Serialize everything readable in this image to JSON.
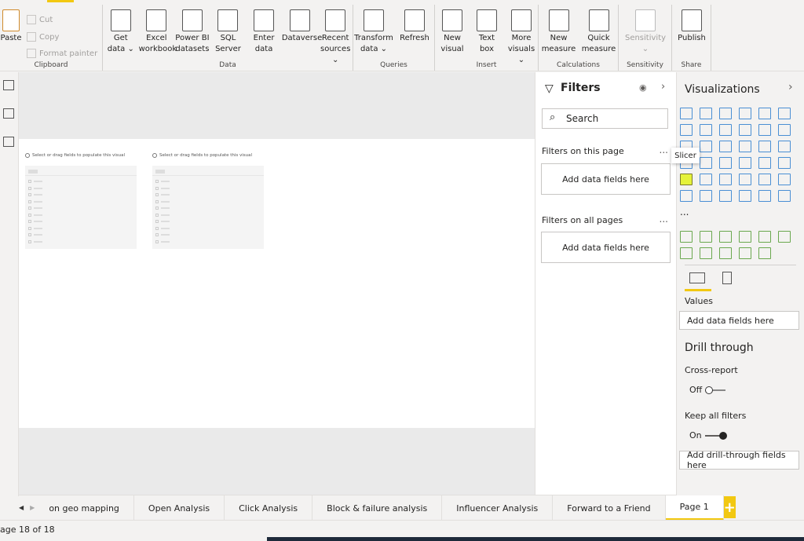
{
  "ribbon": {
    "clipboard": {
      "label": "Clipboard",
      "paste": "Paste",
      "cut": "Cut",
      "copy": "Copy",
      "format_painter": "Format painter"
    },
    "data": {
      "label": "Data",
      "buttons": [
        [
          "Get",
          "data ⌄"
        ],
        [
          "Excel",
          "workbook"
        ],
        [
          "Power BI",
          "datasets"
        ],
        [
          "SQL",
          "Server"
        ],
        [
          "Enter",
          "data"
        ],
        [
          "Dataverse",
          ""
        ],
        [
          "Recent",
          "sources ⌄"
        ]
      ]
    },
    "queries": {
      "label": "Queries",
      "buttons": [
        [
          "Transform",
          "data ⌄"
        ],
        [
          "Refresh",
          ""
        ]
      ]
    },
    "insert": {
      "label": "Insert",
      "buttons": [
        [
          "New",
          "visual"
        ],
        [
          "Text",
          "box"
        ],
        [
          "More",
          "visuals ⌄"
        ]
      ]
    },
    "calculations": {
      "label": "Calculations",
      "buttons": [
        [
          "New",
          "measure"
        ],
        [
          "Quick",
          "measure"
        ]
      ]
    },
    "sensitivity": {
      "label": "Sensitivity",
      "buttons": [
        [
          "Sensitivity",
          "⌄"
        ]
      ]
    },
    "share": {
      "label": "Share",
      "buttons": [
        [
          "Publish",
          ""
        ]
      ]
    }
  },
  "canvas": {
    "visuals": [
      {
        "message": "Select or drag fields to populate this visual"
      },
      {
        "message": "Select or drag fields to populate this visual"
      }
    ]
  },
  "filters": {
    "title": "Filters",
    "search_placeholder": "Search",
    "on_this_page": "Filters on this page",
    "on_all_pages": "Filters on all pages",
    "add_fields": "Add data fields here",
    "more": "..."
  },
  "visualizations": {
    "title": "Visualizations",
    "tooltip": "Slicer",
    "more": "...",
    "values_label": "Values",
    "values_drop": "Add data fields here",
    "drill_through": "Drill through",
    "cross_report": "Cross-report",
    "cross_report_state": "Off",
    "keep_all_filters": "Keep all filters",
    "keep_all_filters_state": "On",
    "drill_drop": "Add drill-through fields here",
    "selected": "slicer"
  },
  "tabs": [
    {
      "label": "on geo mapping"
    },
    {
      "label": "Open Analysis"
    },
    {
      "label": "Click Analysis"
    },
    {
      "label": "Block & failure analysis"
    },
    {
      "label": "Influencer Analysis"
    },
    {
      "label": "Forward to a Friend"
    },
    {
      "label": "Page 1",
      "active": true
    }
  ],
  "add_tab": "+",
  "status": {
    "page": "age 18 of 18"
  },
  "colors": {
    "accent": "#f2c811",
    "viz_blue": "#4a8fd4"
  }
}
